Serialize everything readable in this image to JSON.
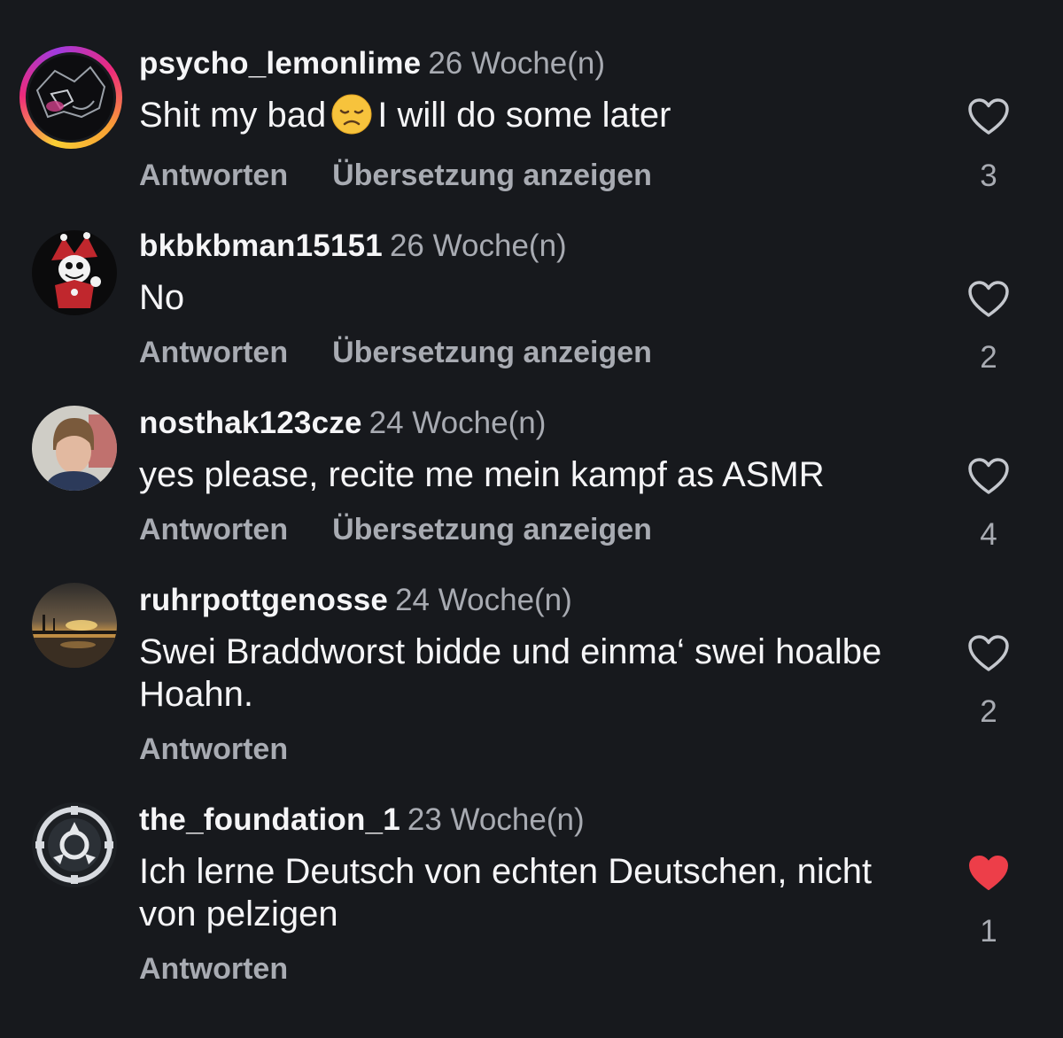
{
  "comments": [
    {
      "username": "psycho_lemonlime",
      "time": "26 Woche(n)",
      "text_before": "Shit my bad",
      "text_after": "I will do some later",
      "reply_label": "Antworten",
      "translate_label": "Übersetzung anzeigen",
      "likes": "3",
      "liked": false
    },
    {
      "username": "bkbkbman15151",
      "time": "26 Woche(n)",
      "text": "No",
      "reply_label": "Antworten",
      "translate_label": "Übersetzung anzeigen",
      "likes": "2",
      "liked": false
    },
    {
      "username": "nosthak123cze",
      "time": "24 Woche(n)",
      "text": "yes please, recite me mein kampf as ASMR",
      "reply_label": "Antworten",
      "translate_label": "Übersetzung anzeigen",
      "likes": "4",
      "liked": false
    },
    {
      "username": "ruhrpottgenosse",
      "time": "24 Woche(n)",
      "text": "Swei Braddworst bidde und einma‘ swei hoalbe Hoahn.",
      "reply_label": "Antworten",
      "likes": "2",
      "liked": false
    },
    {
      "username": "the_foundation_1",
      "time": "23 Woche(n)",
      "text": "Ich lerne Deutsch von echten Deutschen, nicht von pelzigen",
      "reply_label": "Antworten",
      "likes": "1",
      "liked": true
    }
  ],
  "colors": {
    "background": "#17191d",
    "primary_text": "#f5f5f7",
    "secondary_text": "#a8abb2",
    "liked_heart": "#ed3e49"
  },
  "icons": {
    "emoji": "disappointed-face-emoji",
    "like": "heart-outline-icon",
    "liked": "heart-filled-icon"
  }
}
